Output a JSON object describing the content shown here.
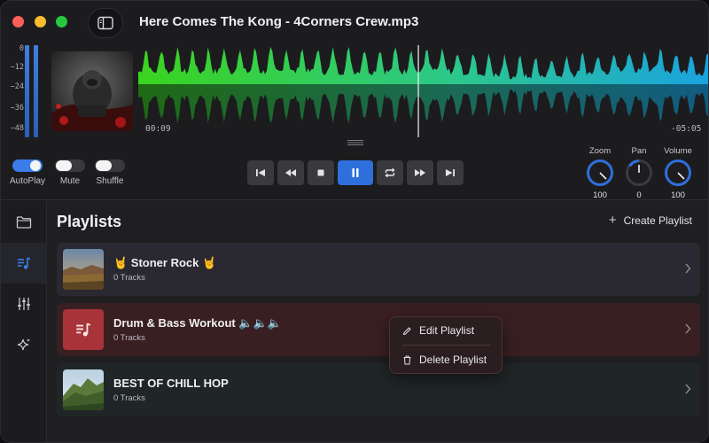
{
  "window": {
    "title": "Here Comes The Kong - 4Corners Crew.mp3"
  },
  "meter": {
    "labels": [
      "0",
      "−12",
      "−24",
      "−36",
      "−48"
    ]
  },
  "player": {
    "elapsed": "00:09",
    "remaining": "-05:05",
    "playhead_position": 0.49
  },
  "toggles": [
    {
      "label": "AutoPlay",
      "on": true
    },
    {
      "label": "Mute",
      "on": false
    },
    {
      "label": "Shuffle",
      "on": false
    }
  ],
  "transport": {
    "buttons": [
      "skip-back-icon",
      "rewind-icon",
      "stop-icon",
      "pause-icon",
      "repeat-icon",
      "fast-forward-icon",
      "skip-forward-icon"
    ]
  },
  "knobs": [
    {
      "label": "Zoom",
      "value": "100"
    },
    {
      "label": "Pan",
      "value": "0"
    },
    {
      "label": "Volume",
      "value": "100"
    }
  ],
  "rail": {
    "items": [
      "folder-icon",
      "playlist-icon",
      "equalizer-icon",
      "sparkle-icon"
    ],
    "active_index": 1
  },
  "main": {
    "title": "Playlists",
    "create_label": "Create Playlist"
  },
  "playlists": [
    {
      "name": "🤘 Stoner Rock 🤘",
      "tracks": "0 Tracks",
      "thumb": "landscape-photo"
    },
    {
      "name": "Drum & Bass Workout 🔈🔈🔈",
      "tracks": "0 Tracks",
      "thumb": "music-note-icon"
    },
    {
      "name": "BEST OF CHILL HOP",
      "tracks": "0 Tracks",
      "thumb": "mountain-photo"
    }
  ],
  "context_menu": {
    "edit_label": "Edit Playlist",
    "delete_label": "Delete Playlist"
  },
  "colors": {
    "accent": "#2f6fdc",
    "waveform_start": "#3ad41e",
    "waveform_end": "#1aa3e0"
  }
}
